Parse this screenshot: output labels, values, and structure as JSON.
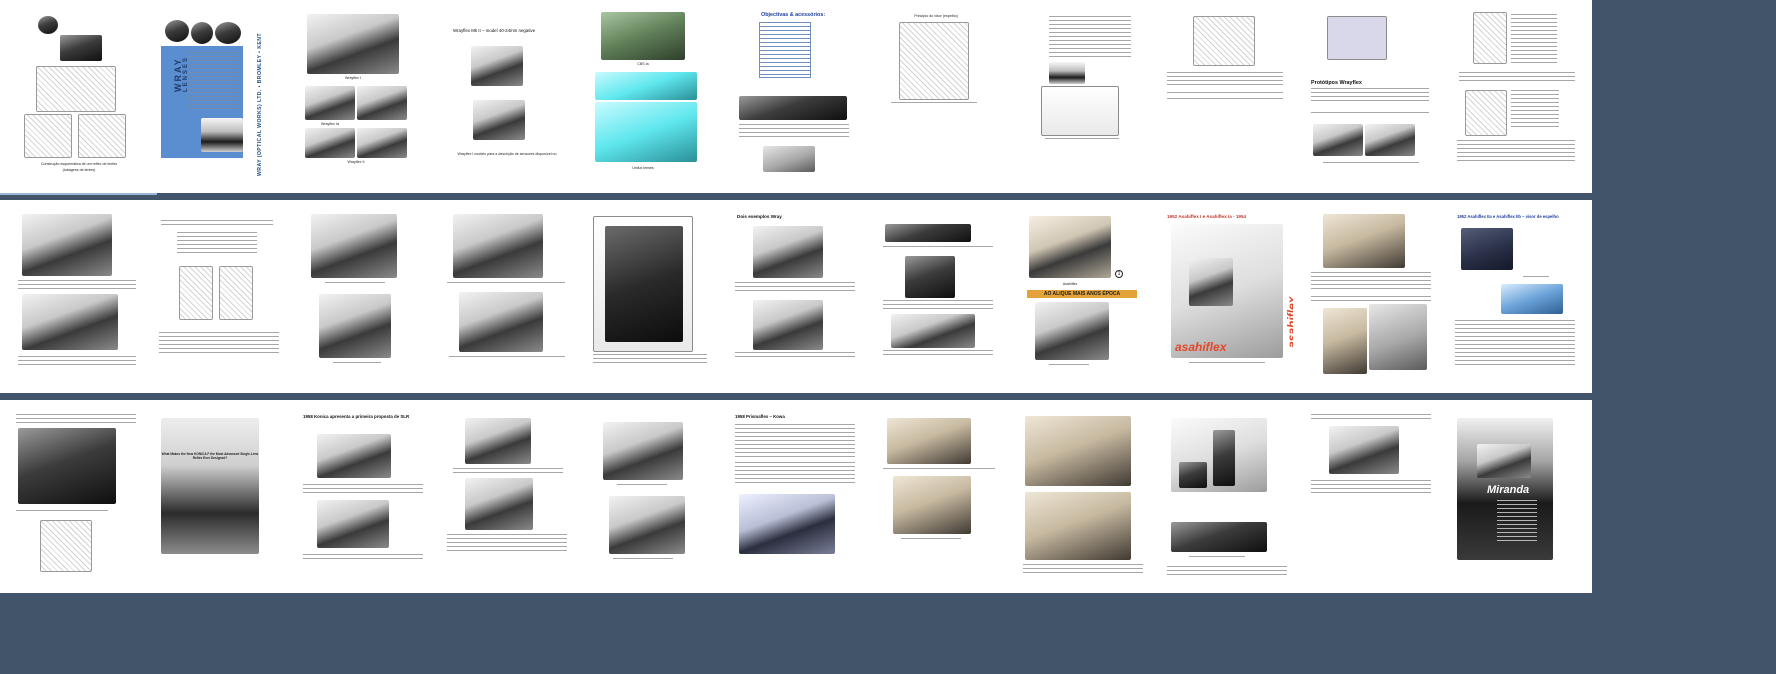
{
  "document": {
    "rows": [
      [
        {
          "captions": [
            "Construção esquemática de um reflex de lentes",
            "(tubagens de lentes)"
          ]
        },
        {
          "captions": [
            "WRAY",
            "LENSES",
            "WRAY (OPTICAL WORKS) LTD. • BROMLEY • KENT"
          ]
        },
        {
          "captions": [
            "Wrayflex I",
            "Wrayflex Ia",
            "Wrayflex II"
          ]
        },
        {
          "captions": [
            "Wrayflex Mk II – model 40-24mm negative",
            "Wrayflex I modelo para a descrição de sensores disponível no"
          ]
        },
        {
          "captions": [
            "Unilux lenses",
            "CBS Ia"
          ]
        },
        {
          "captions": [
            "Objectivas & acessórios:"
          ]
        },
        {
          "captions": [
            "Princípio do visor (espelho)"
          ]
        },
        {
          "captions": []
        },
        {
          "captions": []
        },
        {
          "captions": [
            "Protótipos Wrayflex"
          ]
        },
        {
          "captions": []
        }
      ],
      [
        {
          "captions": []
        },
        {
          "captions": []
        },
        {
          "captions": []
        },
        {
          "captions": []
        },
        {
          "captions": []
        },
        {
          "captions": [
            "Dois exemplos Wray"
          ]
        },
        {
          "captions": []
        },
        {
          "captions": [
            "AO ALIQUE MAIS ANOS ÉPOCA",
            "Asahiflex"
          ]
        },
        {
          "captions": [
            "1952 Asahiflex I e Asahiflex Ia - 1954",
            "asahiflex",
            "asahiflex"
          ]
        },
        {
          "captions": []
        },
        {
          "captions": [
            "1952 Asahiflex IIa e Asahiflex IIb – visor de espelho"
          ]
        }
      ],
      [
        {
          "captions": []
        },
        {
          "captions": [
            "What Makes the New KONICA F the Most Advanced Single-Lens Reflex Ever Designed?"
          ]
        },
        {
          "captions": [
            "1958 Konica apresenta a primeira proposta de SLR"
          ]
        },
        {
          "captions": []
        },
        {
          "captions": []
        },
        {
          "captions": [
            "1958 Prismaflex – Kowa"
          ]
        },
        {
          "captions": []
        },
        {
          "captions": []
        },
        {
          "captions": []
        },
        {
          "captions": []
        },
        {
          "captions": [
            "Miranda"
          ]
        }
      ]
    ]
  }
}
